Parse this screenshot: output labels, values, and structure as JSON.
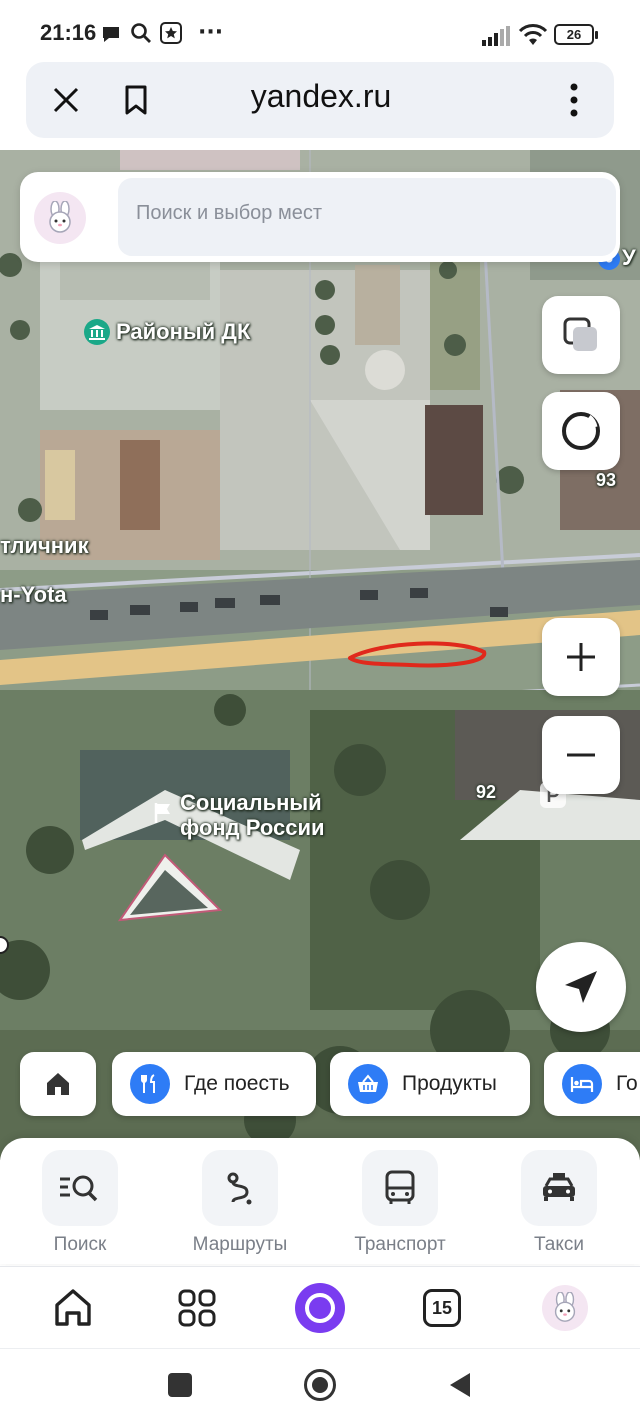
{
  "status_bar": {
    "time": "21:16",
    "battery": "26",
    "more": "···"
  },
  "browser": {
    "url": "yandex.ru"
  },
  "search": {
    "placeholder": "Поиск и выбор мест"
  },
  "map": {
    "labels": {
      "district_dk": "Районый ДК",
      "otlichnik": "тличник",
      "yota": "н-Yota",
      "social_fund_line1": "Социальный",
      "social_fund_line2": "фонд России",
      "num_93": "93",
      "num_92": "92",
      "top_right": "У"
    }
  },
  "chips": [
    {
      "label": ""
    },
    {
      "label": "Где поесть"
    },
    {
      "label": "Продукты"
    },
    {
      "label": "Го"
    }
  ],
  "panel": {
    "items": [
      {
        "label": "Поиск"
      },
      {
        "label": "Маршруты"
      },
      {
        "label": "Транспорт"
      },
      {
        "label": "Такси"
      }
    ]
  },
  "browser_nav": {
    "tabs_count": "15"
  },
  "colors": {
    "accent": "#2e7cf6",
    "alice": "#7a3cf0",
    "road": "#e8c88a",
    "annotation": "#e0291c"
  }
}
